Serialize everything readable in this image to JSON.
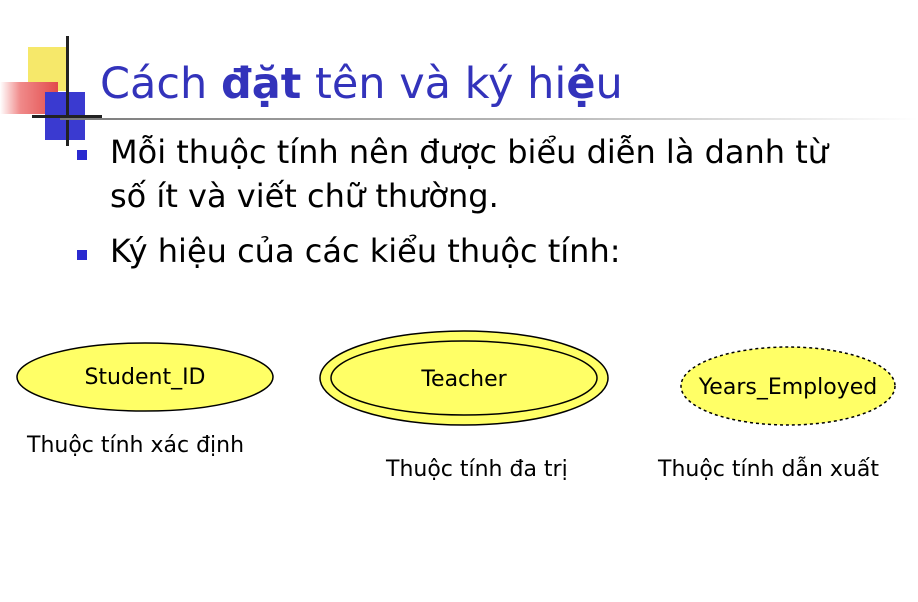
{
  "slide": {
    "title_prefix": "Cách ",
    "title_bold": "đặt",
    "title_mid": " tên và ký hi",
    "title_bold2": "ệ",
    "title_suffix": "u",
    "bullets": [
      {
        "line1": "Mỗi thuộc tính nên được biểu diễn là danh từ",
        "line2": "số ít và viết chữ thường."
      },
      {
        "line1": "Ký hiệu của các kiểu thuộc tính:"
      }
    ]
  },
  "diagram": {
    "fill_color": "#ffff66",
    "attributes": [
      {
        "label": "Student_ID",
        "kind": "key",
        "caption": "Thuộc tính xác định"
      },
      {
        "label": "Teacher",
        "kind": "multivalued",
        "caption": "Thuộc tính đa trị"
      },
      {
        "label": "Years_Employed",
        "kind": "derived",
        "caption": "Thuộc tính dẫn xuất"
      }
    ]
  }
}
